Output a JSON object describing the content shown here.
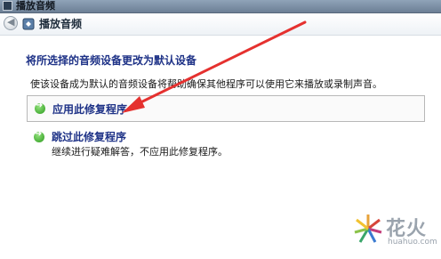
{
  "window": {
    "title": "播放音频"
  },
  "nav": {
    "title": "播放音频"
  },
  "main": {
    "heading": "将所选择的音频设备更改为默认设备",
    "description": "使该设备成为默认的音频设备将帮助确保其他程序可以使用它来播放或录制声音。",
    "options": [
      {
        "title": "应用此修复程序",
        "subtitle": ""
      },
      {
        "title": "跳过此修复程序",
        "subtitle": "继续进行疑难解答，不应用此修复程序。"
      }
    ]
  },
  "annotation": {
    "color": "#e5312f"
  },
  "watermark": {
    "brand": "花火",
    "domain": "huahuo.com"
  }
}
